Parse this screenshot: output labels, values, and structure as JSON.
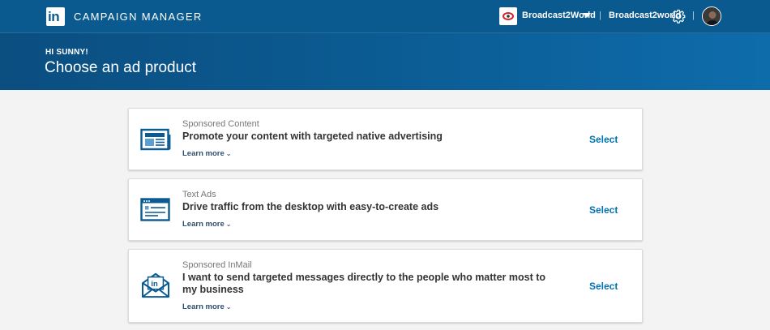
{
  "topbar": {
    "app_title": "CAMPAIGN MANAGER",
    "account_name": "Broadcast2World",
    "account_link": "Broadcast2world",
    "separator": "|"
  },
  "hero": {
    "greeting": "HI SUNNY!",
    "title": "Choose an ad product"
  },
  "products": [
    {
      "kicker": "Sponsored Content",
      "headline": "Promote your content with targeted native advertising",
      "learn_more": "Learn more",
      "action": "Select",
      "icon": "newspaper-icon"
    },
    {
      "kicker": "Text Ads",
      "headline": "Drive traffic from the desktop with easy-to-create ads",
      "learn_more": "Learn more",
      "action": "Select",
      "icon": "browser-window-icon"
    },
    {
      "kicker": "Sponsored InMail",
      "headline": "I want to send targeted messages directly to the people who matter most to my business",
      "learn_more": "Learn more",
      "action": "Select",
      "icon": "inmail-envelope-icon"
    }
  ],
  "colors": {
    "topbar": "#0a5a8f",
    "accent": "#0073b1",
    "background": "#f3f3f3"
  }
}
